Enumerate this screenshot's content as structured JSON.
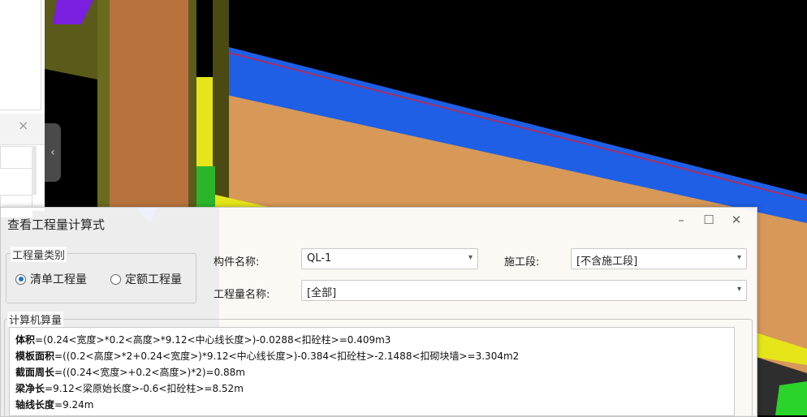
{
  "dialog": {
    "title": "查看工程量计算式",
    "minimize": "–",
    "maximize": "☐",
    "close": "✕",
    "category_group": {
      "legend": "工程量类别",
      "options": [
        {
          "label": "清单工程量",
          "selected": true
        },
        {
          "label": "定额工程量",
          "selected": false
        }
      ]
    },
    "component_name": {
      "label": "构件名称:",
      "value": "QL-1"
    },
    "construction_stage": {
      "label": "施工段:",
      "value": "[不含施工段]"
    },
    "quantity_name": {
      "label": "工程量名称:",
      "value": "[全部]"
    },
    "calc_group": {
      "legend": "计算机算量",
      "lines": [
        {
          "key": "体积",
          "rest": "=(0.24<宽度>*0.2<高度>*9.12<中心线长度>)-0.0288<扣砼柱>=0.409m3"
        },
        {
          "key": "模板面积",
          "rest": "=((0.2<高度>*2+0.24<宽度>)*9.12<中心线长度>)-0.384<扣砼柱>-2.1488<扣砌块墙>=3.304m2"
        },
        {
          "key": "截面周长",
          "rest": "=((0.24<宽度>+0.2<高度>)*2)=0.88m"
        },
        {
          "key": "梁净长",
          "rest": "=9.12<梁原始长度>-0.6<扣砼柱>=8.52m"
        },
        {
          "key": "轴线长度",
          "rest": "=9.24m"
        }
      ]
    }
  },
  "left_panel": {
    "close": "×",
    "collapse": "‹"
  },
  "colors": {
    "accent": "#1a73c9",
    "beam_blue": "#1e5fe6",
    "wall_orange": "#d79858",
    "column_yellow": "#e5e51a",
    "column_green": "#2bb52b"
  }
}
